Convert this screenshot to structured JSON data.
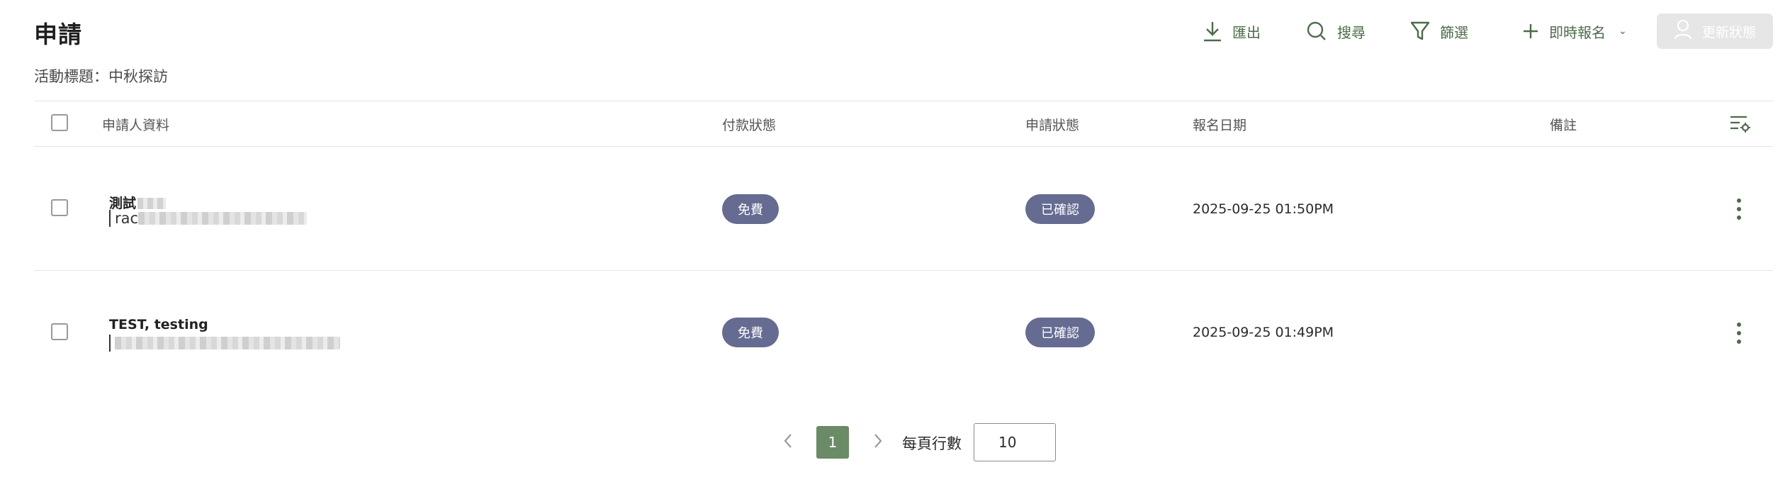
{
  "header": {
    "title": "申請",
    "subtitle": "活動標題：中秋探訪"
  },
  "toolbar": {
    "export_label": "匯出",
    "search_label": "搜尋",
    "filter_label": "篩選",
    "register_label": "即時報名",
    "update_label": "更新狀態",
    "accent_color": "#4d6b4a",
    "disabled_color": "#e6e6e6"
  },
  "table": {
    "columns": {
      "applicant": "申請人資料",
      "payment": "付款狀態",
      "status": "申請狀態",
      "date": "報名日期",
      "note": "備註"
    },
    "rows": [
      {
        "name": "測試",
        "email": "rac",
        "payment": "免費",
        "status": "已確認",
        "date": "2025-09-25 01:50PM"
      },
      {
        "name": "TEST, testing",
        "email": "",
        "payment": "免費",
        "status": "已確認",
        "date": "2025-09-25 01:49PM"
      }
    ],
    "pill_color": "#656b91"
  },
  "pagination": {
    "current_page": "1",
    "rows_per_page_label": "每頁行數",
    "rows_per_page": "10",
    "active_color": "#6b8a66"
  }
}
